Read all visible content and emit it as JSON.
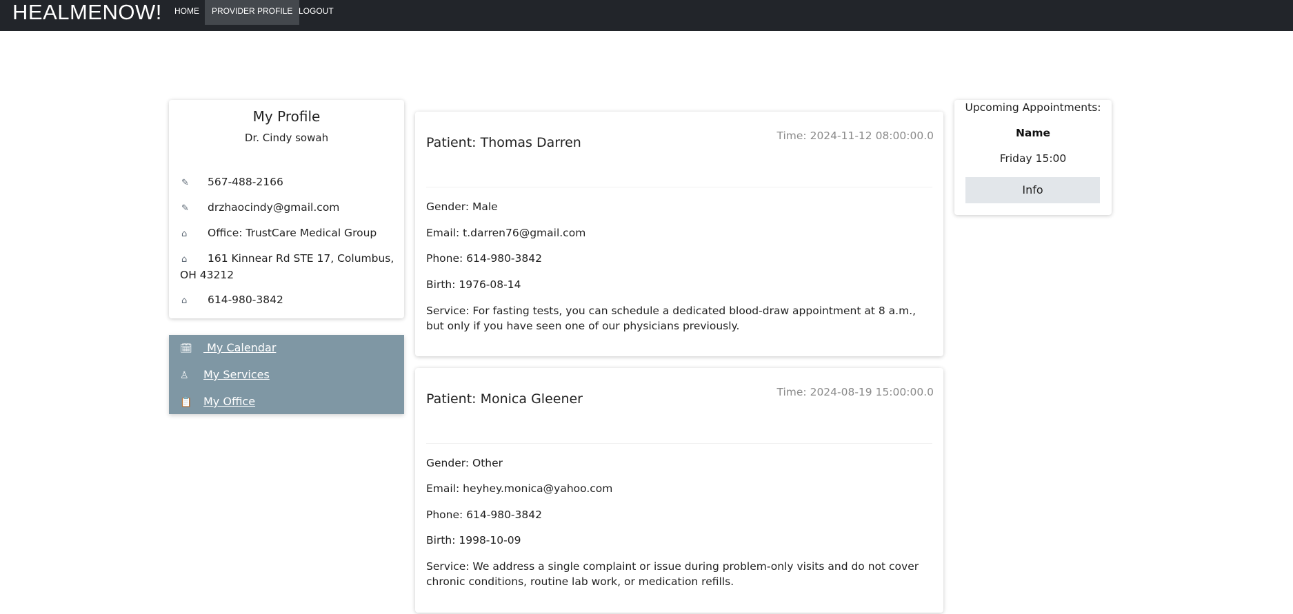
{
  "navbar": {
    "brand": "HEALMENOW!",
    "links": [
      "HOME",
      "PROVIDER PROFILE",
      "LOGOUT"
    ]
  },
  "profile": {
    "title": "My Profile",
    "name": "Dr. Cindy sowah",
    "rows": [
      {
        "icon": "pencil-icon",
        "text": "567-488-2166"
      },
      {
        "icon": "pencil-icon",
        "text": "drzhaocindy@gmail.com"
      },
      {
        "icon": "home-icon",
        "text": "Office: TrustCare Medical Group"
      },
      {
        "icon": "home-icon",
        "text": "161 Kinnear Rd STE 17, Columbus, OH 43212"
      },
      {
        "icon": "home-icon",
        "text": "614-980-3842"
      }
    ]
  },
  "menu": {
    "items": [
      {
        "icon": "calendar-check-icon",
        "label": " My Calendar"
      },
      {
        "icon": "user-doctor-icon",
        "label": "My Services"
      },
      {
        "icon": "clipboard-icon",
        "label": "My Office"
      }
    ]
  },
  "patients": [
    {
      "title": "Patient: Thomas Darren",
      "time": "Time: 2024-11-12 08:00:00.0",
      "gender": "Gender: Male",
      "email": "Email: t.darren76@gmail.com",
      "phone": "Phone: 614-980-3842",
      "birth": "Birth: 1976-08-14",
      "service": "Service: For fasting tests, you can schedule a dedicated blood-draw appointment at 8 a.m., but only if you have seen one of our physicians previously."
    },
    {
      "title": "Patient: Monica Gleener",
      "time": "Time: 2024-08-19 15:00:00.0",
      "gender": "Gender: Other",
      "email": "Email: heyhey.monica@yahoo.com",
      "phone": "Phone: 614-980-3842",
      "birth": "Birth: 1998-10-09",
      "service": "Service: We address a single complaint or issue during problem-only visits and do not cover chronic conditions, routine lab work, or medication refills."
    }
  ],
  "appointments": {
    "heading": "Upcoming Appointments:",
    "name_label": "Name",
    "time": "Friday 15:00",
    "info_button": "Info"
  }
}
